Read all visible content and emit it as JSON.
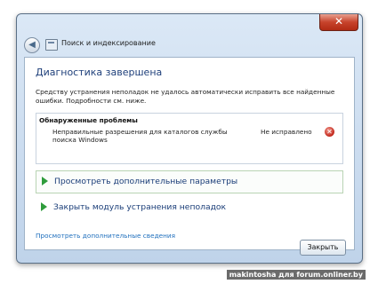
{
  "window": {
    "title": "Поиск и индексирование",
    "close_glyph": "✕"
  },
  "main": {
    "heading": "Диагностика завершена",
    "description": "Средству устранения неполадок не удалось автоматически исправить все найденные ошибки. Подробности см. ниже.",
    "problems": {
      "title": "Обнаруженные проблемы",
      "items": [
        {
          "description": "Неправильные разрешения для каталогов службы поиска Windows",
          "status": "Не исправлено",
          "icon": "error-icon"
        }
      ]
    },
    "actions": [
      {
        "label": "Просмотреть дополнительные параметры"
      },
      {
        "label": "Закрыть модуль устранения неполадок"
      }
    ],
    "more_info_link": "Просмотреть дополнительные сведения"
  },
  "footer": {
    "close_button": "Закрыть"
  },
  "watermark": "makintosha для forum.onliner.by",
  "colors": {
    "heading": "#1e3f7a",
    "link": "#1f6fbd",
    "arrow": "#2e9c3b",
    "error": "#c1261a"
  }
}
